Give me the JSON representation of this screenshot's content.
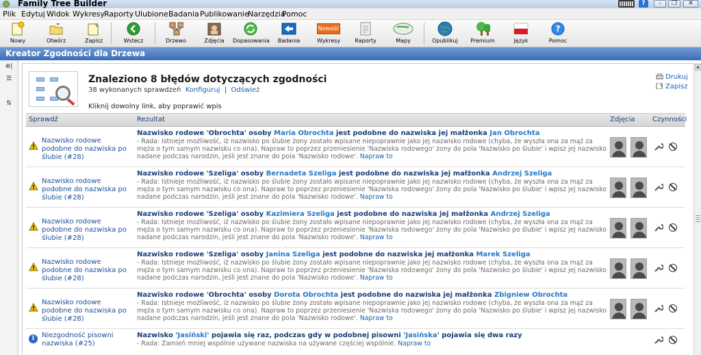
{
  "window": {
    "title": "Family Tree Builder",
    "help_button": "?"
  },
  "menu": [
    "Plik",
    "Edytuj",
    "Widok",
    "Wykresy",
    "Raporty",
    "Ulubione",
    "Badania",
    "Publikowanie",
    "Narzędzia",
    "Pomoc"
  ],
  "toolbar": {
    "nowy": "Nowy",
    "otworz": "Otwórz",
    "zapisz": "Zapisz",
    "wstecz": "Wstecz",
    "drzewo": "Drzewo",
    "zdjecia": "Zdjęcia",
    "dopasowania": "Dopasowania",
    "badania": "Badania",
    "wykresy": "Wykresy",
    "nowosc_badge": "Nowość",
    "raporty": "Raporty",
    "mapy": "Mapy",
    "opublikuj": "Opublikuj",
    "premium": "Premium",
    "jezyk": "Język",
    "pomoc": "Pomoc"
  },
  "panel_title": "Kreator Zgodności dla Drzewa",
  "summary": {
    "headline": "Znaleziono 8 błędów dotyczących zgodności",
    "checks_done": "38 wykonanych sprawdzeń",
    "configure": "Konfiguruj",
    "separator": "|",
    "refresh": "Odśwież",
    "hint": "Kliknij dowolny link, aby poprawić wpis"
  },
  "actions": {
    "print": "Drukuj",
    "save": "Zapisz"
  },
  "table": {
    "headers": {
      "check": "Sprawdź",
      "result": "Rezultat",
      "photos": "Zdjęcia",
      "actions": "Czynności"
    },
    "rows": [
      {
        "check": "Nazwisko rodowe podobne do nazwiska po ślubie (#28)",
        "r1": "Nazwisko rodowe 'Obrochta' osoby ",
        "p1": "Maria Obrochta",
        "r2": " jest podobne do nazwiska jej małżonka ",
        "p2": "Jan Obrochta",
        "tip": "- Rada: Istnieje możliwość, iż nazwisko po ślubie żony zostało wpisane niepoprawnie jako jej nazwisko rodowe (chyba, że wyszła ona za mąż za męża o tym samym nazwisku co ona). Napraw to poprzez przeniesienie 'Nazwiska rodowego' żony do pola 'Nazwisko po ślubie' i wpisz jej nazwisko nadane podczas narodzin, jeśli jest znane do pola 'Nazwisko rodowe'.",
        "fix": "Napraw to"
      },
      {
        "check": "Nazwisko rodowe podobne do nazwiska po ślubie (#28)",
        "r1": "Nazwisko rodowe 'Szeliga' osoby ",
        "p1": "Bernadeta Szeliga",
        "r2": " jest podobne do nazwiska jej małżonka ",
        "p2": "Andrzej Szeliga",
        "tip": "- Rada: Istnieje możliwość, iż nazwisko po ślubie żony zostało wpisane niepoprawnie jako jej nazwisko rodowe (chyba, że wyszła ona za mąż za męża o tym samym nazwisku co ona). Napraw to poprzez przeniesienie 'Nazwiska rodowego' żony do pola 'Nazwisko po ślubie' i wpisz jej nazwisko nadane podczas narodzin, jeśli jest znane do pola 'Nazwisko rodowe'.",
        "fix": "Napraw to"
      },
      {
        "check": "Nazwisko rodowe podobne do nazwiska po ślubie (#28)",
        "r1": "Nazwisko rodowe 'Szeliga' osoby ",
        "p1": "Kazimiera Szeliga",
        "r2": " jest podobne do nazwiska jej małżonka ",
        "p2": "Andrzej Szeliga",
        "tip": "- Rada: Istnieje możliwość, iż nazwisko po ślubie żony zostało wpisane niepoprawnie jako jej nazwisko rodowe (chyba, że wyszła ona za mąż za męża o tym samym nazwisku co ona). Napraw to poprzez przeniesienie 'Nazwiska rodowego' żony do pola 'Nazwisko po ślubie' i wpisz jej nazwisko nadane podczas narodzin, jeśli jest znane do pola 'Nazwisko rodowe'.",
        "fix": "Napraw to"
      },
      {
        "check": "Nazwisko rodowe podobne do nazwiska po ślubie (#28)",
        "r1": "Nazwisko rodowe 'Szeliga' osoby ",
        "p1": "Janina Szeliga",
        "r2": " jest podobne do nazwiska jej małżonka ",
        "p2": "Marek Szeliga",
        "tip": "- Rada: Istnieje możliwość, iż nazwisko po ślubie żony zostało wpisane niepoprawnie jako jej nazwisko rodowe (chyba, że wyszła ona za mąż za męża o tym samym nazwisku co ona). Napraw to poprzez przeniesienie 'Nazwiska rodowego' żony do pola 'Nazwisko po ślubie' i wpisz jej nazwisko nadane podczas narodzin, jeśli jest znane do pola 'Nazwisko rodowe'.",
        "fix": "Napraw to"
      },
      {
        "check": "Nazwisko rodowe podobne do nazwiska po ślubie (#28)",
        "r1": "Nazwisko rodowe 'Obrochta' osoby ",
        "p1": "Dorota Obrochta",
        "r2": " jest podobne do nazwiska jej małżonka ",
        "p2": "Zbigniew Obrochta",
        "tip": "- Rada: Istnieje możliwość, iż nazwisko po ślubie żony zostało wpisane niepoprawnie jako jej nazwisko rodowe (chyba, że wyszła ona za mąż za męża o tym samym nazwisku co ona). Napraw to poprzez przeniesienie 'Nazwiska rodowego' żony do pola 'Nazwisko po ślubie' i wpisz jej nazwisko nadane podczas narodzin, jeśli jest znane do pola 'Nazwisko rodowe'.",
        "fix": "Napraw to"
      },
      {
        "check": "Niezgodność pisowni nazwiska (#25)",
        "r1": "Nazwisko '",
        "q1": "Jasiński",
        "r2": "' pojawia się raz, podczas gdy w podobnej pisowni '",
        "q2": "Jasińska",
        "r3": "' pojawia się dwa razy",
        "tip": "- Rada: Zamień mniej wspólnie używane nazwiska na używane częściej wspólnie.",
        "fix": "Napraw to"
      }
    ]
  },
  "icons": {
    "warning": "warning-triangle-icon",
    "info": "info-circle-icon",
    "wrench": "wrench-icon",
    "ignore": "ignore-icon",
    "photo": "silhouette-photo-icon"
  },
  "colors": {
    "header_strip": "#3c6db5",
    "link": "#1a5fb4",
    "person_link": "#2478c8",
    "warning": "#f5c400"
  }
}
